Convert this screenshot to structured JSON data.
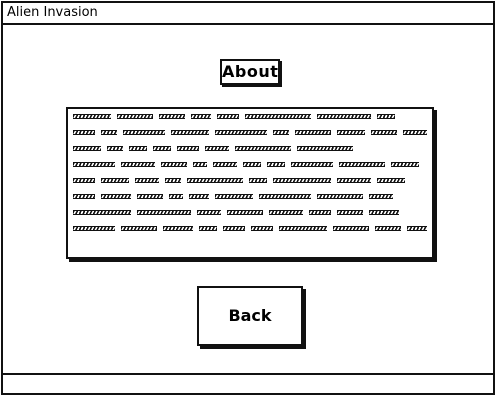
{
  "window": {
    "title": "Alien Invasion"
  },
  "about": {
    "heading": "About",
    "body_text_lines": [
      [
        38,
        36,
        26,
        20,
        22,
        66,
        54,
        18
      ],
      [
        22,
        16,
        42,
        38,
        52,
        16,
        36,
        28,
        26,
        28
      ],
      [
        28,
        16,
        18,
        18,
        22,
        24,
        56,
        56
      ],
      [
        42,
        34,
        26,
        14,
        24,
        18,
        18,
        42,
        46,
        28
      ],
      [
        22,
        28,
        24,
        16,
        56,
        18,
        58,
        34,
        28
      ],
      [
        22,
        30,
        26,
        14,
        20,
        38,
        52,
        46,
        24
      ],
      [
        58,
        54,
        24,
        36,
        34,
        22,
        26,
        30
      ],
      [
        42,
        36,
        30,
        18,
        22,
        22,
        48,
        36,
        26,
        20
      ]
    ]
  },
  "buttons": {
    "back_label": "Back"
  }
}
